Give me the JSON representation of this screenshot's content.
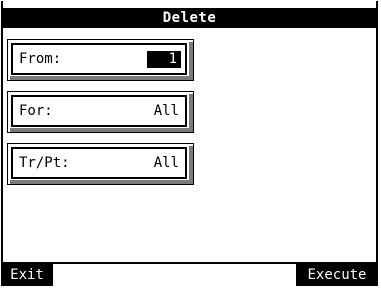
{
  "title": "Delete",
  "params": [
    {
      "label": "From:",
      "value": "1",
      "selected": true
    },
    {
      "label": "For:",
      "value": "All",
      "selected": false
    },
    {
      "label": "Tr/Pt:",
      "value": "All",
      "selected": false
    }
  ],
  "buttons": {
    "exit": "Exit",
    "execute": "Execute"
  }
}
